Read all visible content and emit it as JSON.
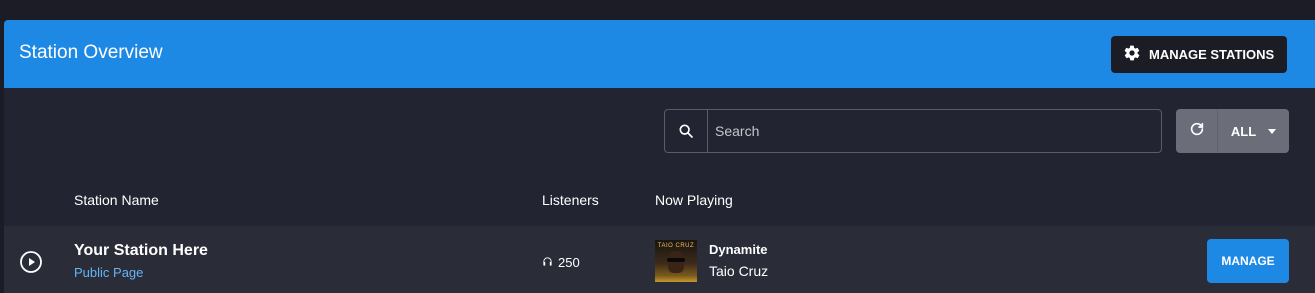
{
  "header": {
    "title": "Station Overview",
    "manage_stations_label": "MANAGE STATIONS",
    "manage_stations_icon": "gear-icon"
  },
  "toolbar": {
    "search_placeholder": "Search",
    "search_value": "",
    "refresh_icon": "refresh-icon",
    "filter_label": "ALL"
  },
  "table": {
    "columns": [
      "Station Name",
      "Listeners",
      "Now Playing"
    ],
    "rows": [
      {
        "station_name": "Your Station Here",
        "public_page_label": "Public Page",
        "listeners": "250",
        "album_art_text": "TAIO CRUZ",
        "song_title": "Dynamite",
        "song_artist": "Taio Cruz",
        "manage_label": "MANAGE"
      }
    ]
  },
  "colors": {
    "accent": "#1e88e5",
    "background": "#222431",
    "row_background": "#2a2c38",
    "link": "#64b5f6"
  }
}
